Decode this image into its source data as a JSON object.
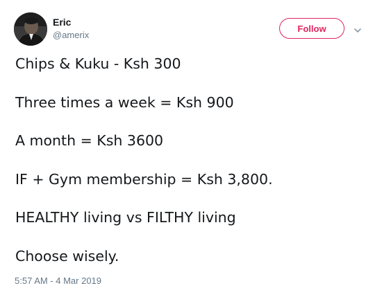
{
  "tweet": {
    "author": {
      "display_name": "Eric",
      "handle": "@amerix",
      "avatar_icon": "profile-photo"
    },
    "follow_label": "Follow",
    "menu_icon": "chevron-down-icon",
    "accent_color": "#e0245e",
    "lines": [
      "Chips & Kuku - Ksh 300",
      "Three times a week = Ksh 900",
      "A month = Ksh 3600",
      "IF + Gym membership = Ksh 3,800.",
      "HEALTHY living vs FILTHY living",
      "Choose wisely."
    ],
    "timestamp": "5:57 AM - 4 Mar 2019"
  }
}
